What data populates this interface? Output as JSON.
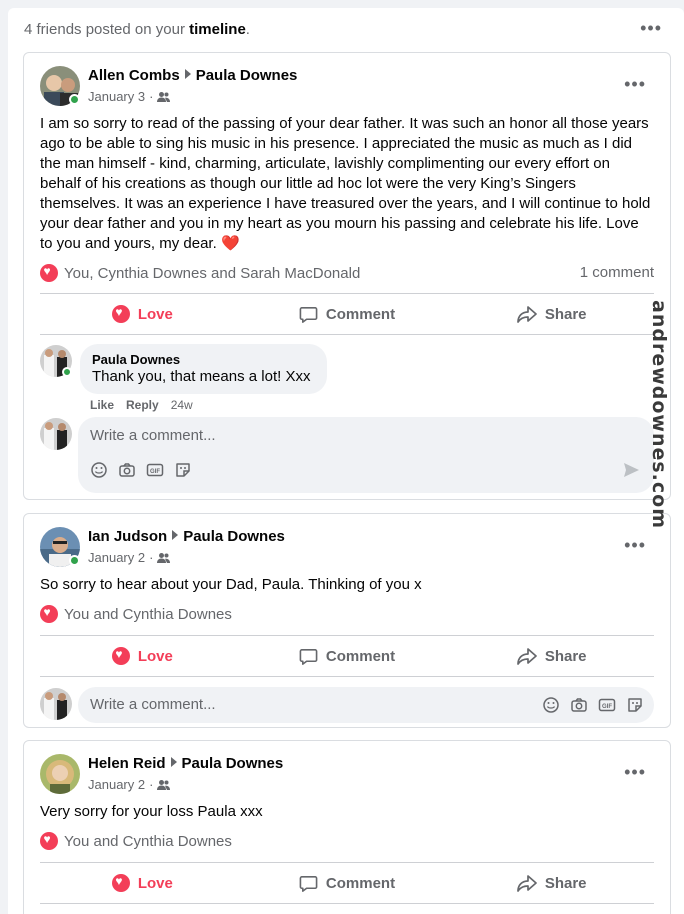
{
  "summary": {
    "prefix": "4 friends posted on your",
    "bold": "timeline",
    "suffix": "."
  },
  "more_label": "•••",
  "posts": [
    {
      "author": "Allen Combs",
      "target": "Paula Downes",
      "date": "January 3",
      "privacy_icon": "friends-icon",
      "text": "I am so sorry to read of the passing of your dear father. It was such an honor all those years ago to be able to sing his music in his presence. I appreciated the music as much as I did the man himself - kind, charming, articulate, lavishly complimenting our every effort on behalf of his creations as though our little ad hoc lot were the very King’s Singers themselves. It was an experience I have treasured over the years, and I will continue to hold your dear father and you in my heart as you mourn his passing and celebrate his life. Love to you and yours, my dear.",
      "text_emoji": "❤️",
      "reactions": "You, Cynthia Downes and Sarah MacDonald",
      "comment_count": "1 comment",
      "actions": {
        "love": "Love",
        "comment": "Comment",
        "share": "Share"
      },
      "comment": {
        "author": "Paula Downes",
        "text": "Thank you, that means a lot! Xxx",
        "like": "Like",
        "reply": "Reply",
        "time": "24w"
      },
      "composer_placeholder": "Write a comment..."
    },
    {
      "author": "Ian Judson",
      "target": "Paula Downes",
      "date": "January 2",
      "privacy_icon": "friends-icon",
      "text": "So sorry to hear about your Dad, Paula. Thinking of you x",
      "reactions": "You and Cynthia Downes",
      "actions": {
        "love": "Love",
        "comment": "Comment",
        "share": "Share"
      },
      "composer_placeholder": "Write a comment..."
    },
    {
      "author": "Helen Reid",
      "target": "Paula Downes",
      "date": "January 2",
      "privacy_icon": "friends-icon",
      "text": "Very sorry for your loss Paula xxx",
      "reactions": "You and Cynthia Downes",
      "actions": {
        "love": "Love",
        "comment": "Comment",
        "share": "Share"
      }
    }
  ],
  "watermark": "andrewdownes.com",
  "colors": {
    "love": "#f33e58",
    "online": "#31a24c",
    "secondary_text": "#65676b",
    "page_bg": "#f0f2f5"
  }
}
